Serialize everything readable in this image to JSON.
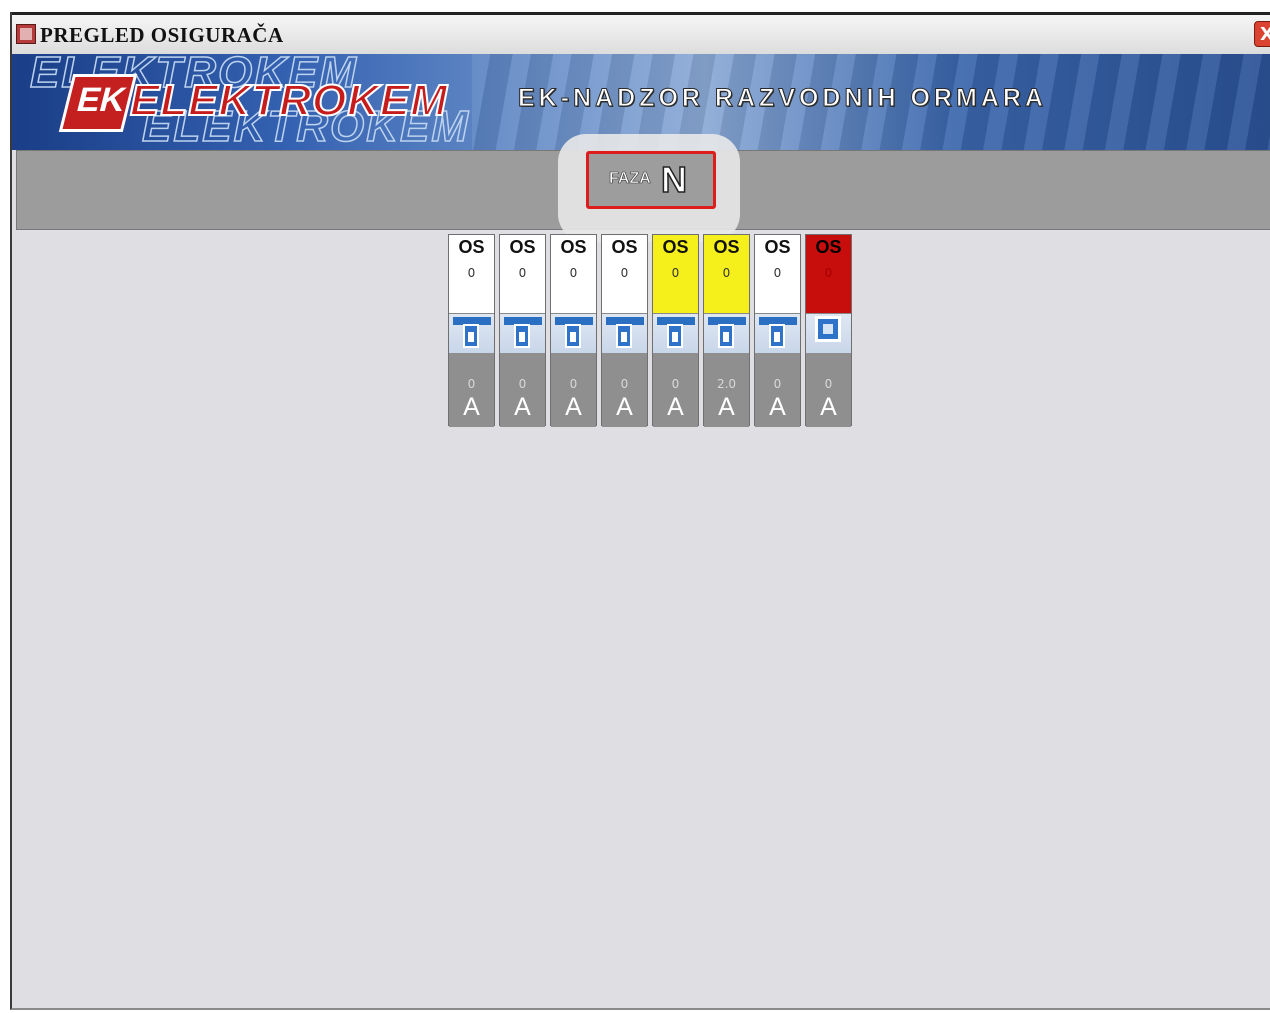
{
  "window": {
    "title": "PREGLED OSIGURAČA",
    "close_symbol": "X"
  },
  "banner": {
    "brand": "ELEKTROKEM",
    "logo_initials": "EK",
    "app_title": "EK-NADZOR RAZVODNIH ORMARA"
  },
  "phase": {
    "label": "FAZA",
    "value": "N"
  },
  "fuses": [
    {
      "name": "OS",
      "count": "0",
      "amp": "0",
      "unit": "A",
      "state": "normal"
    },
    {
      "name": "OS",
      "count": "0",
      "amp": "0",
      "unit": "A",
      "state": "normal"
    },
    {
      "name": "OS",
      "count": "0",
      "amp": "0",
      "unit": "A",
      "state": "normal"
    },
    {
      "name": "OS",
      "count": "0",
      "amp": "0",
      "unit": "A",
      "state": "normal"
    },
    {
      "name": "OS",
      "count": "0",
      "amp": "0",
      "unit": "A",
      "state": "warning"
    },
    {
      "name": "OS",
      "count": "0",
      "amp": "2.0",
      "unit": "A",
      "state": "warning"
    },
    {
      "name": "OS",
      "count": "0",
      "amp": "0",
      "unit": "A",
      "state": "normal"
    },
    {
      "name": "OS",
      "count": "0",
      "amp": "0",
      "unit": "A",
      "state": "tripped"
    }
  ],
  "colors": {
    "normal": "#ffffff",
    "warning": "#f5f01c",
    "tripped": "#c80d0d",
    "switch_blue": "#2e73c9"
  }
}
